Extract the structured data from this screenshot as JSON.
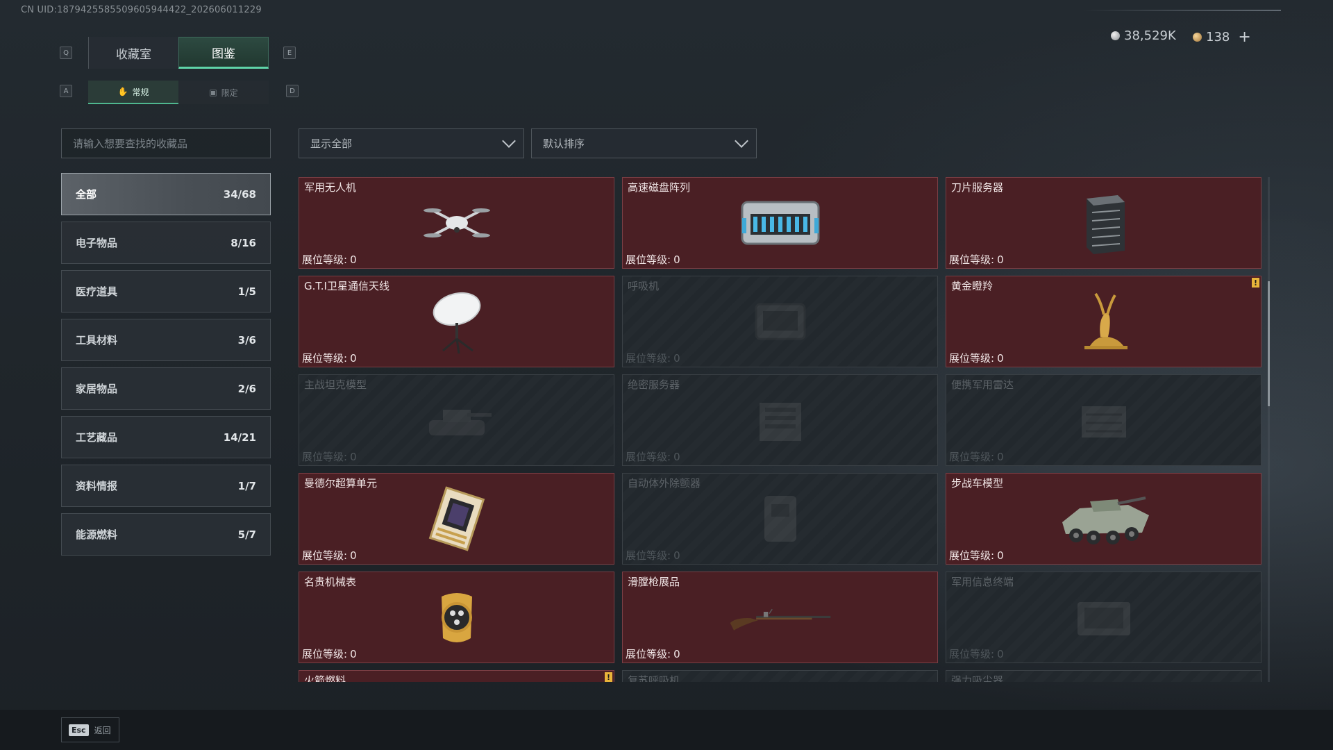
{
  "uid_text": "CN UID:1879425585509605944422_202606011229",
  "currency": {
    "silver": "38,529K",
    "gold": "138",
    "add": "+"
  },
  "keys": {
    "prev_tab": "Q",
    "next_tab": "E",
    "prev_sub": "A",
    "next_sub": "D"
  },
  "tabs": [
    {
      "label": "收藏室",
      "active": false
    },
    {
      "label": "图鉴",
      "active": true
    }
  ],
  "subtabs": [
    {
      "label": "常规",
      "icon": "hand-icon",
      "active": true
    },
    {
      "label": "限定",
      "icon": "image-icon",
      "active": false
    }
  ],
  "search": {
    "placeholder": "请输入想要查找的收藏品"
  },
  "categories": [
    {
      "label": "全部",
      "count": "34/68",
      "active": true
    },
    {
      "label": "电子物品",
      "count": "8/16"
    },
    {
      "label": "医疗道具",
      "count": "1/5"
    },
    {
      "label": "工具材料",
      "count": "3/6"
    },
    {
      "label": "家居物品",
      "count": "2/6"
    },
    {
      "label": "工艺藏品",
      "count": "14/21"
    },
    {
      "label": "资料情报",
      "count": "1/7"
    },
    {
      "label": "能源燃料",
      "count": "5/7"
    }
  ],
  "filters": {
    "show": "显示全部",
    "sort": "默认排序"
  },
  "level_label": "展位等级:",
  "items": [
    {
      "name": "军用无人机",
      "level": "0",
      "unlocked": true,
      "icon": "drone-icon"
    },
    {
      "name": "高速磁盘阵列",
      "level": "0",
      "unlocked": true,
      "icon": "disk-array-icon"
    },
    {
      "name": "刀片服务器",
      "level": "0",
      "unlocked": true,
      "icon": "blade-server-icon"
    },
    {
      "name": "G.T.I卫星通信天线",
      "level": "0",
      "unlocked": true,
      "icon": "satellite-antenna-icon"
    },
    {
      "name": "呼吸机",
      "level": "0",
      "unlocked": false,
      "icon": "ventilator-icon"
    },
    {
      "name": "黄金瞪羚",
      "level": "0",
      "unlocked": true,
      "icon": "golden-gazelle-icon",
      "badge": "!"
    },
    {
      "name": "主战坦克模型",
      "level": "0",
      "unlocked": false,
      "icon": "tank-model-icon"
    },
    {
      "name": "绝密服务器",
      "level": "0",
      "unlocked": false,
      "icon": "secret-server-icon"
    },
    {
      "name": "便携军用雷达",
      "level": "0",
      "unlocked": false,
      "icon": "radar-icon"
    },
    {
      "name": "曼德尔超算单元",
      "level": "0",
      "unlocked": true,
      "icon": "gpu-unit-icon"
    },
    {
      "name": "自动体外除颤器",
      "level": "0",
      "unlocked": false,
      "icon": "defibrillator-icon"
    },
    {
      "name": "步战车模型",
      "level": "0",
      "unlocked": true,
      "icon": "ifv-model-icon"
    },
    {
      "name": "名贵机械表",
      "level": "0",
      "unlocked": true,
      "icon": "watch-icon"
    },
    {
      "name": "滑膛枪展品",
      "level": "0",
      "unlocked": true,
      "icon": "musket-icon"
    },
    {
      "name": "军用信息终端",
      "level": "0",
      "unlocked": false,
      "icon": "terminal-icon"
    },
    {
      "name": "火箭燃料",
      "level": "",
      "unlocked": true,
      "icon": "rocket-fuel-icon",
      "badge": "!"
    },
    {
      "name": "复苏呼吸机",
      "level": "",
      "unlocked": false,
      "icon": "respirator-icon"
    },
    {
      "name": "强力吸尘器",
      "level": "",
      "unlocked": false,
      "icon": "vacuum-icon"
    }
  ],
  "footer": {
    "esc_key": "Esc",
    "back_label": "返回"
  }
}
